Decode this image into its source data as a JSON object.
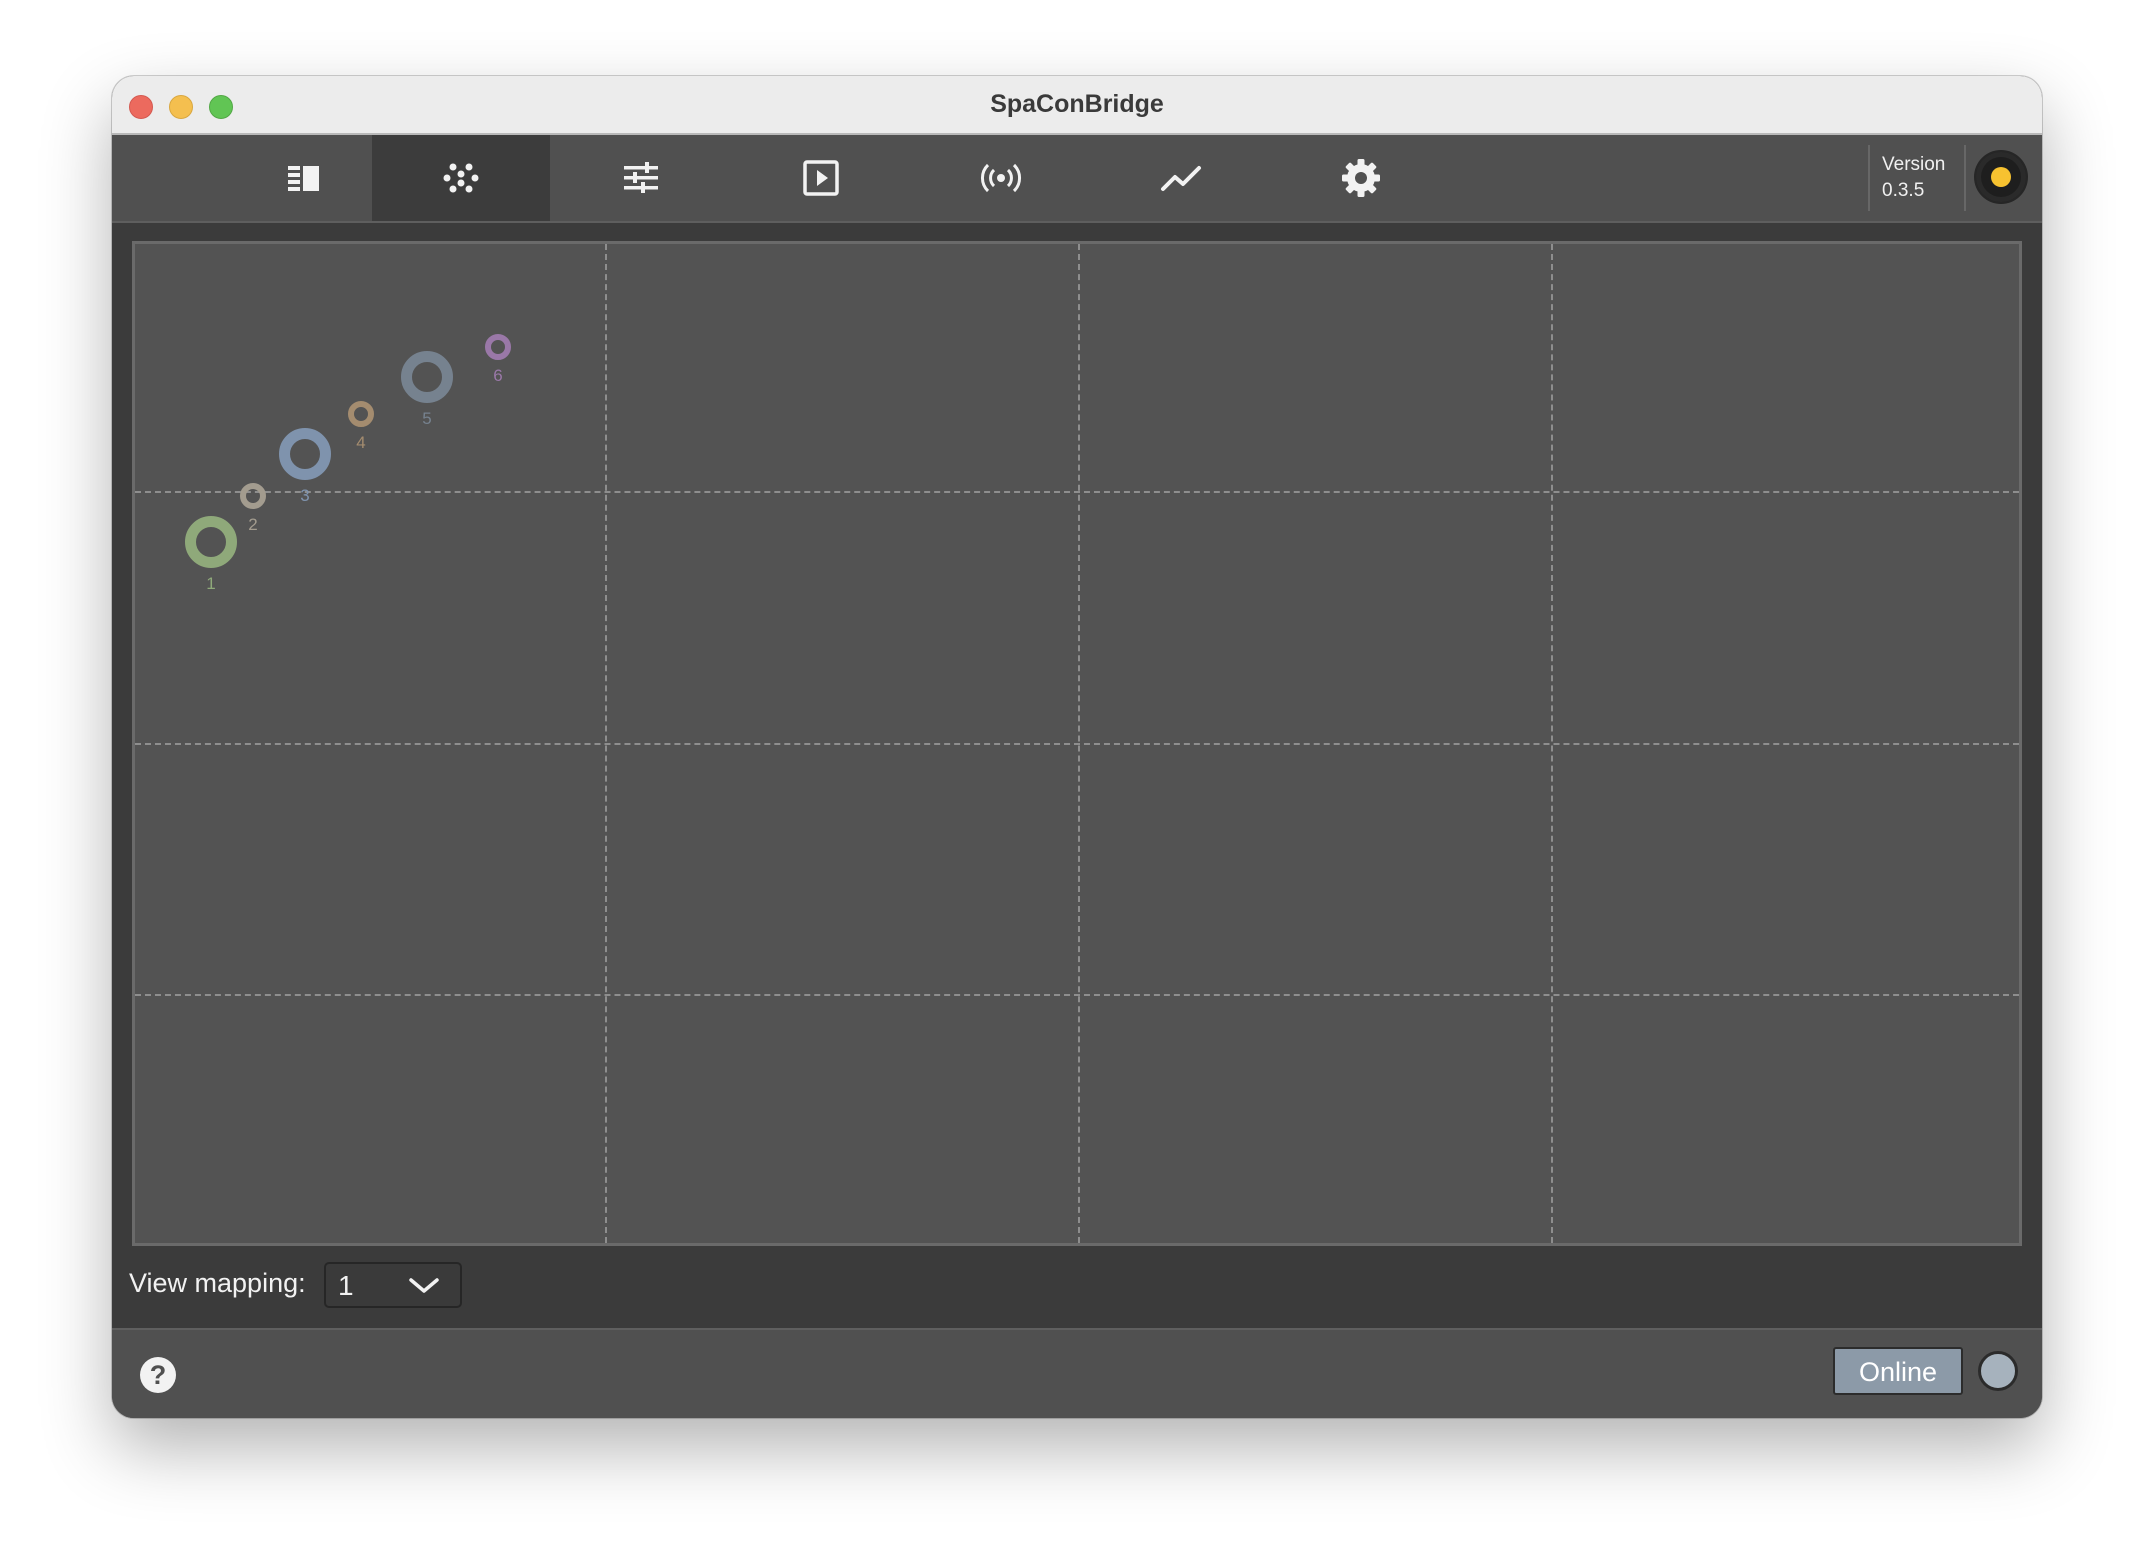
{
  "window": {
    "title": "SpaConBridge"
  },
  "toolbar": {
    "tabs": [
      {
        "name": "tab-soundobject-table",
        "icon": "table-view-icon",
        "active": false
      },
      {
        "name": "tab-multi-slider",
        "icon": "multi-slider-icon",
        "active": true
      },
      {
        "name": "tab-mixer",
        "icon": "sliders-icon",
        "active": false
      },
      {
        "name": "tab-scenes",
        "icon": "play-icon",
        "active": false
      },
      {
        "name": "tab-enspace",
        "icon": "broadcast-icon",
        "active": false
      },
      {
        "name": "tab-statistics",
        "icon": "chart-line-icon",
        "active": false
      },
      {
        "name": "tab-settings",
        "icon": "gear-icon",
        "active": false
      }
    ],
    "version_label": "Version",
    "version_value": "0.3.5"
  },
  "sources": [
    {
      "label": "1",
      "color": "#8fa97a"
    },
    {
      "label": "2",
      "color": "#a39c8f"
    },
    {
      "label": "3",
      "color": "#7f93ad"
    },
    {
      "label": "4",
      "color": "#a48c6f"
    },
    {
      "label": "5",
      "color": "#76828f"
    },
    {
      "label": "6",
      "color": "#9a78a8"
    }
  ],
  "mapping": {
    "label": "View mapping:",
    "selected": "1"
  },
  "footer": {
    "help": "?",
    "online_button": "Online"
  },
  "colors": {
    "accent": "#f7c230",
    "online": "#8c9aa8",
    "canvas": "#535353"
  }
}
